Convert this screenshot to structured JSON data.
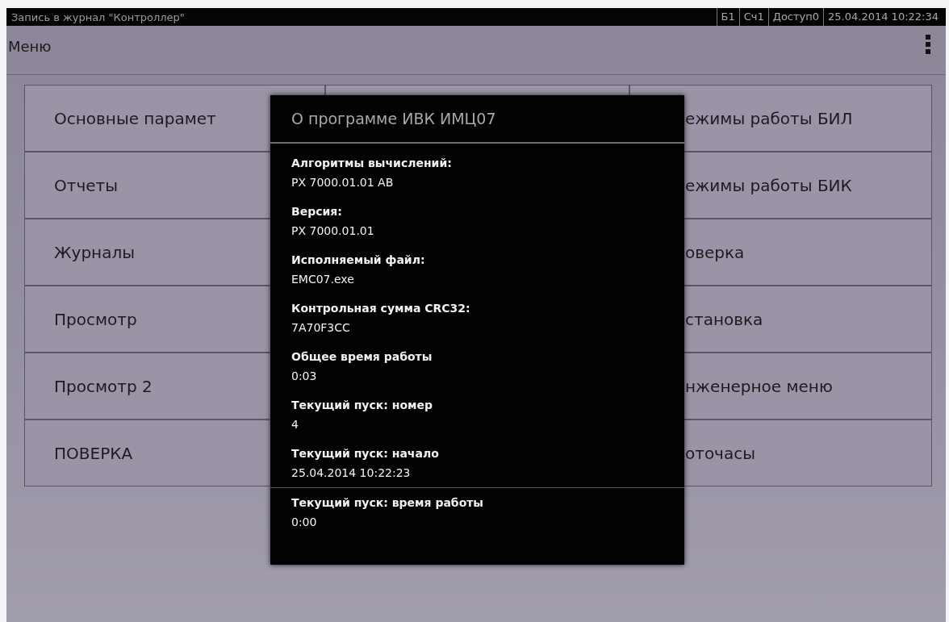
{
  "top_bar": {
    "title": "Запись в журнал \"Контроллер\"",
    "indicators": [
      "Б1",
      "Сч1",
      "Доступ0"
    ],
    "datetime": "25.04.2014 10:22:34"
  },
  "header": {
    "title": "Меню"
  },
  "menu": {
    "left_column": [
      "Основные парамет",
      "Отчеты",
      "Журналы",
      "Просмотр",
      "Просмотр 2",
      "ПОВЕРКА"
    ],
    "right_column": [
      "ежимы работы БИЛ",
      "ежимы работы БИК",
      "оверка",
      "становка",
      "нженерное меню",
      "оточасы"
    ]
  },
  "dialog": {
    "title": "О программе  ИВК ИМЦ07",
    "fields": [
      {
        "label": "Алгоритмы вычислений:",
        "value": "PX 7000.01.01 AB"
      },
      {
        "label": "Версия:",
        "value": "PX 7000.01.01"
      },
      {
        "label": "Исполняемый файл:",
        "value": "EMC07.exe"
      },
      {
        "label": "Контрольная сумма CRC32:",
        "value": "7A70F3CC"
      },
      {
        "label": "Общее время работы",
        "value": "0:03"
      },
      {
        "label": "Текущий пуск: номер",
        "value": "4"
      },
      {
        "label": "Текущий пуск: начало",
        "value": "25.04.2014 10:22:23"
      },
      {
        "label": "Текущий пуск: время работы",
        "value": "0:00"
      }
    ]
  }
}
